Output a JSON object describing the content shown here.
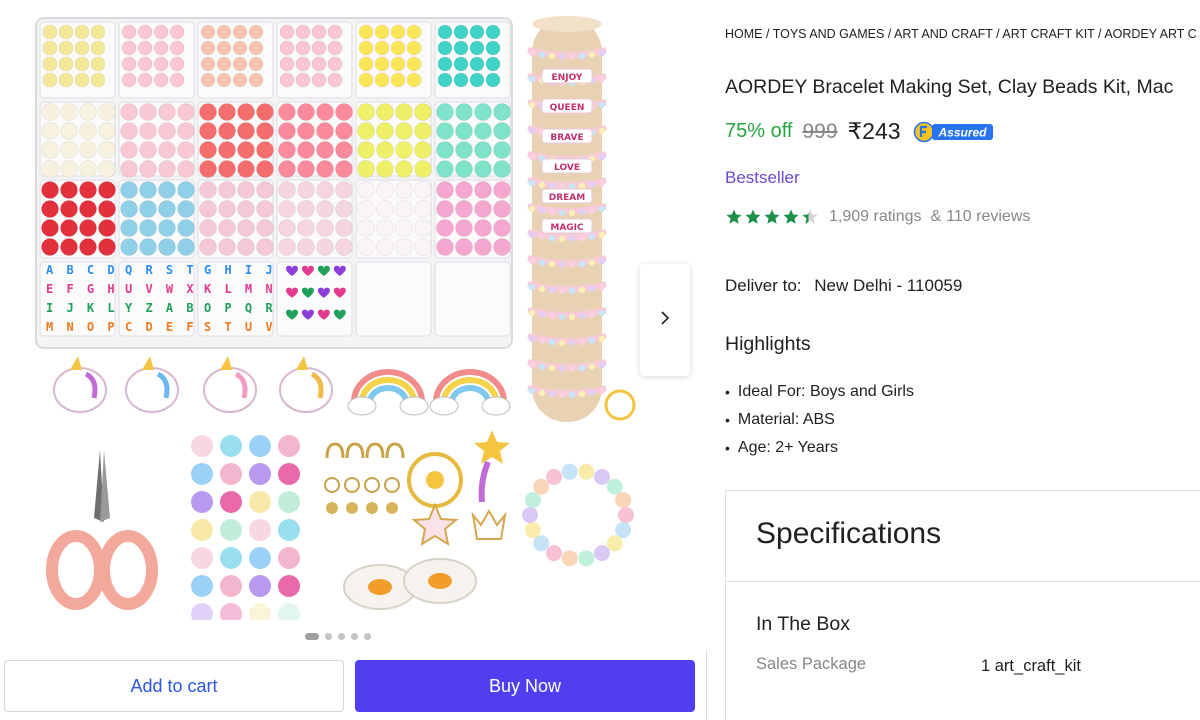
{
  "breadcrumb": [
    "Home",
    "Toys and Games",
    "Art and Craft",
    "Art Craft Kit",
    "AORDEY ART C"
  ],
  "product": {
    "title": "AORDEY Bracelet Making Set, Clay Beads Kit, Mac",
    "discount": "75% off",
    "mrp": "999",
    "price": "₹243",
    "assured_label": "Assured",
    "badge": "Bestseller",
    "rating": 4.4,
    "ratings_text": "1,909 ratings",
    "amp": "&",
    "reviews_text": "110 reviews"
  },
  "delivery": {
    "label": "Deliver to:",
    "location": "New Delhi - 110059"
  },
  "highlights": {
    "title": "Highlights",
    "items": [
      "Ideal For: Boys and Girls",
      "Material: ABS",
      "Age: 2+ Years"
    ]
  },
  "specifications": {
    "title": "Specifications",
    "section": "In The Box",
    "rows": [
      {
        "label": "Sales Package",
        "value": "1 art_craft_kit"
      }
    ]
  },
  "gallery": {
    "image_count": 5,
    "active_index": 0,
    "next_icon": "chevron-right-icon",
    "bracelet_letters": [
      "ENJOY",
      "QUEEN",
      "BRAVE",
      "LOVE",
      "DREAM",
      "MAGIC"
    ],
    "bead_letters": [
      "A B C D",
      "Q R S T",
      "G H I J",
      "E F G H",
      "U V W X",
      "K L M N",
      "I J K L",
      "Y Z A B",
      "O P Q R",
      "M N O P",
      "C D E F",
      "S T U V"
    ]
  },
  "actions": {
    "add_to_cart": "Add to cart",
    "buy_now": "Buy Now"
  },
  "colors": {
    "discount_green": "#26a541",
    "star_green": "#1c9046",
    "bestseller_purple": "#6e48c7",
    "buy_button": "#4f3ff0",
    "cart_text": "#2a55e5",
    "assured_blue": "#2874f0"
  }
}
